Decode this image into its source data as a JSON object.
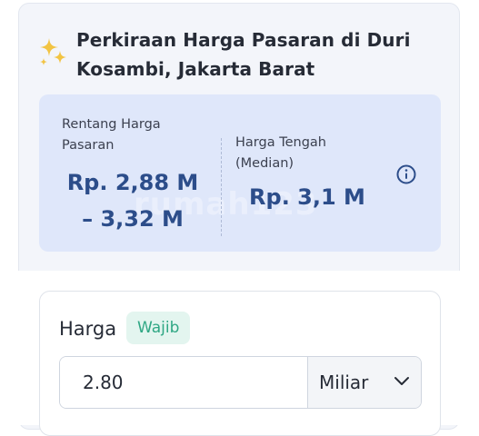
{
  "header": {
    "icon": "sparkles-icon",
    "title": "Perkiraan Harga Pasaran di Duri Kosambi, Jakarta Barat"
  },
  "estimate": {
    "range_label": "Rentang Harga Pasaran",
    "range_value": "Rp. 2,88 M – 3,32 M",
    "median_label": "Harga Tengah (Median)",
    "median_value": "Rp. 3,1 M",
    "info_icon": "info-icon",
    "watermark": "rumah123"
  },
  "price_form": {
    "label": "Harga",
    "required_badge": "Wajib",
    "value": "2.80",
    "unit": "Miliar",
    "unit_icon": "chevron-down-icon"
  },
  "colors": {
    "accent_blue": "#2c4d8a",
    "estimate_bg": "#dfe7fa",
    "sparkle_gold": "#f2c443",
    "badge_green": "#2fa784"
  }
}
